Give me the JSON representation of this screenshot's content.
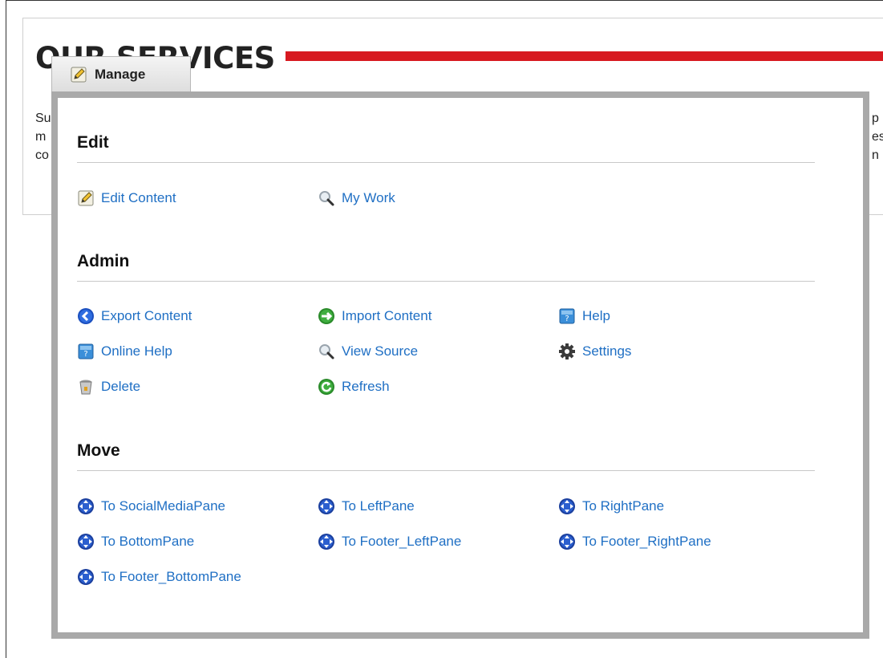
{
  "module": {
    "title": "OUR SERVICES",
    "text_left": [
      "Su",
      "m",
      "co"
    ],
    "text_right": [
      "p",
      "es",
      "n"
    ]
  },
  "manage_button": {
    "label": "Manage",
    "icon": "pencil-icon"
  },
  "sections": {
    "edit": {
      "title": "Edit",
      "items": [
        {
          "label": "Edit Content",
          "icon": "edit-pencil-icon"
        },
        {
          "label": "My Work",
          "icon": "magnifier-icon"
        }
      ]
    },
    "admin": {
      "title": "Admin",
      "items": [
        {
          "label": "Export Content",
          "icon": "export-arrow-icon"
        },
        {
          "label": "Import Content",
          "icon": "import-arrow-icon"
        },
        {
          "label": "Help",
          "icon": "help-book-icon"
        },
        {
          "label": "Online Help",
          "icon": "online-help-book-icon"
        },
        {
          "label": "View Source",
          "icon": "magnifier-icon"
        },
        {
          "label": "Settings",
          "icon": "gear-icon"
        },
        {
          "label": "Delete",
          "icon": "trash-bin-icon"
        },
        {
          "label": "Refresh",
          "icon": "refresh-icon"
        }
      ]
    },
    "move": {
      "title": "Move",
      "items": [
        {
          "label": "To SocialMediaPane",
          "icon": "move-arrows-icon"
        },
        {
          "label": "To LeftPane",
          "icon": "move-arrows-icon"
        },
        {
          "label": "To RightPane",
          "icon": "move-arrows-icon"
        },
        {
          "label": "To BottomPane",
          "icon": "move-arrows-icon"
        },
        {
          "label": "To Footer_LeftPane",
          "icon": "move-arrows-icon"
        },
        {
          "label": "To Footer_RightPane",
          "icon": "move-arrows-icon"
        },
        {
          "label": "To Footer_BottomPane",
          "icon": "move-arrows-icon"
        }
      ]
    }
  },
  "colors": {
    "link": "#1f6fc4",
    "accent_bar": "#d71920",
    "panel_border": "#a9a9a9"
  }
}
